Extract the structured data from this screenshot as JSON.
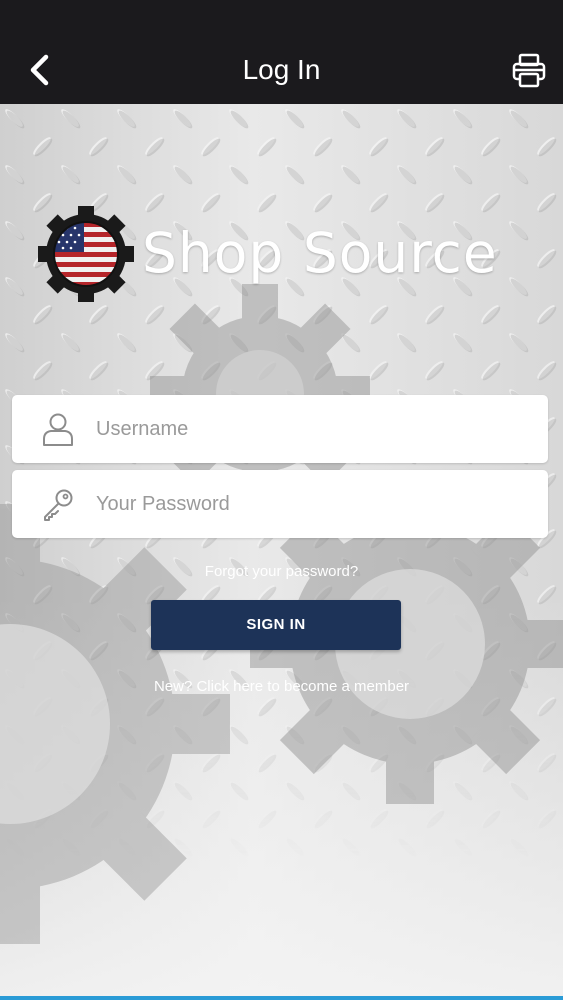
{
  "header": {
    "title": "Log In"
  },
  "brand": {
    "name": "Shop Source"
  },
  "login_form": {
    "username": {
      "value": "",
      "placeholder": "Username"
    },
    "password": {
      "value": "",
      "placeholder": "Your Password"
    },
    "forgot_label": "Forgot your password?",
    "signin_label": "SIGN IN",
    "new_member_label": "New? Click here to become a member"
  },
  "icons": {
    "back": "chevron-left-icon",
    "print": "printer-icon",
    "user": "user-icon",
    "key": "key-icon",
    "logo": "flag-gear-logo"
  },
  "colors": {
    "header_bg": "#1b1a1d",
    "button_bg": "#1d3358",
    "accent_bar": "#2a9bd6"
  }
}
